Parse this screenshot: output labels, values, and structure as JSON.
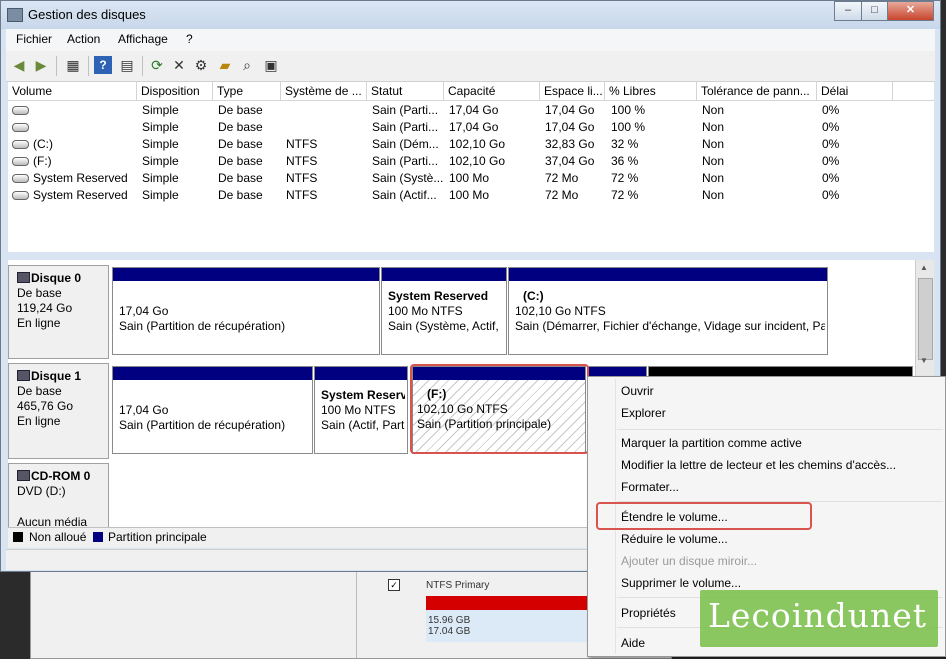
{
  "window": {
    "title": "Gestion des disques",
    "min": "–",
    "max": "□",
    "close": "✕"
  },
  "menu": [
    {
      "label": "Fichier"
    },
    {
      "label": "Action"
    },
    {
      "label": "Affichage"
    },
    {
      "label": "?"
    }
  ],
  "toolbar": [
    "back-icon",
    "forward-icon",
    "properties-grid-icon",
    "help-icon",
    "console-icon",
    "refresh-icon",
    "delete-icon",
    "settings-icon",
    "open-folder-icon",
    "search-icon",
    "find-volume-icon"
  ],
  "columns": [
    "Volume",
    "Disposition",
    "Type",
    "Système de ...",
    "Statut",
    "Capacité",
    "Espace li...",
    "% Libres",
    "Tolérance de pann...",
    "Délai"
  ],
  "volumes": [
    {
      "volume": "",
      "disposition": "Simple",
      "type": "De base",
      "fs": "",
      "statut": "Sain (Parti...",
      "capacite": "17,04 Go",
      "espace": "17,04 Go",
      "libres": "100 %",
      "tolerance": "Non",
      "delai": "0%"
    },
    {
      "volume": "",
      "disposition": "Simple",
      "type": "De base",
      "fs": "",
      "statut": "Sain (Parti...",
      "capacite": "17,04 Go",
      "espace": "17,04 Go",
      "libres": "100 %",
      "tolerance": "Non",
      "delai": "0%"
    },
    {
      "volume": "(C:)",
      "disposition": "Simple",
      "type": "De base",
      "fs": "NTFS",
      "statut": "Sain (Dém...",
      "capacite": "102,10 Go",
      "espace": "32,83 Go",
      "libres": "32 %",
      "tolerance": "Non",
      "delai": "0%"
    },
    {
      "volume": "(F:)",
      "disposition": "Simple",
      "type": "De base",
      "fs": "NTFS",
      "statut": "Sain (Parti...",
      "capacite": "102,10 Go",
      "espace": "37,04 Go",
      "libres": "36 %",
      "tolerance": "Non",
      "delai": "0%"
    },
    {
      "volume": "System Reserved",
      "disposition": "Simple",
      "type": "De base",
      "fs": "NTFS",
      "statut": "Sain (Systè...",
      "capacite": "100 Mo",
      "espace": "72 Mo",
      "libres": "72 %",
      "tolerance": "Non",
      "delai": "0%"
    },
    {
      "volume": "System Reserved",
      "disposition": "Simple",
      "type": "De base",
      "fs": "NTFS",
      "statut": "Sain (Actif...",
      "capacite": "100 Mo",
      "espace": "72 Mo",
      "libres": "72 %",
      "tolerance": "Non",
      "delai": "0%"
    }
  ],
  "disks": {
    "disk0": {
      "name": "Disque 0",
      "type": "De base",
      "size": "119,24 Go",
      "status": "En ligne",
      "p1": {
        "l1": "17,04 Go",
        "l2": "Sain (Partition de récupération)"
      },
      "p2": {
        "l1": "System Reserved",
        "l2": "100 Mo NTFS",
        "l3": "Sain (Système, Actif,"
      },
      "p3": {
        "l1": "(C:)",
        "l2": "102,10 Go NTFS",
        "l3": "Sain (Démarrer, Fichier d'échange, Vidage sur incident, Par"
      }
    },
    "disk1": {
      "name": "Disque 1",
      "type": "De base",
      "size": "465,76 Go",
      "status": "En ligne",
      "p1": {
        "l1": "17,04 Go",
        "l2": "Sain (Partition de récupération)"
      },
      "p2": {
        "l1": "System Reserv",
        "l2": "100 Mo NTFS",
        "l3": "Sain (Actif, Part"
      },
      "p3": {
        "l1": "(F:)",
        "l2": "102,10 Go NTFS",
        "l3": "Sain (Partition principale)"
      }
    },
    "cdrom": {
      "name": "CD-ROM 0",
      "drive": "DVD (D:)",
      "media": "Aucun média"
    }
  },
  "legend": {
    "unallocated": "Non alloué",
    "primary": "Partition principale",
    "color_unallocated": "#000000",
    "color_primary": "#000080"
  },
  "context_menu": {
    "open": "Ouvrir",
    "explore": "Explorer",
    "mark_active": "Marquer la partition comme active",
    "change_letter": "Modifier la lettre de lecteur et les chemins d'accès...",
    "format": "Formater...",
    "extend": "Étendre le volume...",
    "shrink": "Réduire le volume...",
    "mirror": "Ajouter un disque miroir...",
    "delete": "Supprimer le volume...",
    "properties": "Propriétés",
    "help": "Aide"
  },
  "background_window": {
    "type": "NTFS Primary",
    "size1": "15.96 GB",
    "size2": "17.04 GB"
  },
  "watermark": "Lecoindunet"
}
